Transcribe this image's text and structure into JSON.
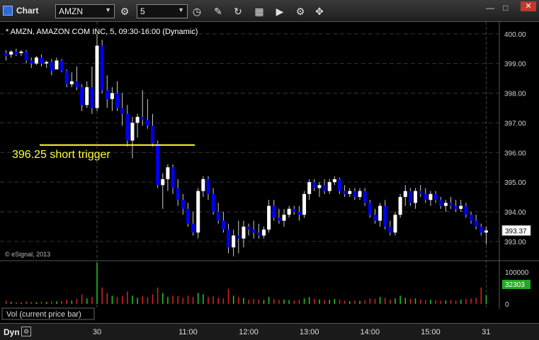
{
  "window": {
    "title": "Chart",
    "symbol": "AMZN",
    "interval": "5",
    "minimize": "—",
    "maximize": "□",
    "close": "✕"
  },
  "toolbar": {
    "icons": [
      "gear-icon",
      "clock-icon",
      "pencil-icon",
      "refresh-icon",
      "chart-type-icon",
      "play-icon",
      "settings-icon"
    ]
  },
  "chart_data": {
    "type": "candlestick",
    "title": "* AMZN, AMAZON COM INC, 5, 09:30-16:00 (Dynamic)",
    "watermark": "© eSignal, 2013",
    "ylim": [
      392.4,
      400.4
    ],
    "y_ticks": [
      "393.00",
      "394.00",
      "395.00",
      "396.00",
      "397.00",
      "398.00",
      "399.00",
      "400.00"
    ],
    "last_price": "393.37",
    "annotation": {
      "text": "396.25 short trigger",
      "price": 396.25
    },
    "volume_label": "Vol (current price bar)",
    "volume_tick": "100000",
    "volume_zero": "0",
    "volume_last": "32303",
    "x_labels": [
      "30",
      "11:00",
      "12:00",
      "13:00",
      "14:00",
      "15:00",
      "31"
    ],
    "x_label_bars": [
      18,
      36,
      48,
      60,
      72,
      84,
      96
    ],
    "up_color": "#ffffff",
    "down_color": "#0000ee",
    "candles": [
      [
        399.35,
        399.45,
        399.1,
        399.25
      ],
      [
        399.3,
        399.45,
        399.2,
        399.4
      ],
      [
        399.4,
        399.5,
        399.25,
        399.3
      ],
      [
        399.35,
        399.45,
        399.25,
        399.4
      ],
      [
        399.4,
        399.45,
        399.0,
        399.1
      ],
      [
        399.1,
        399.2,
        398.85,
        399.0
      ],
      [
        399.0,
        399.25,
        398.95,
        399.2
      ],
      [
        399.2,
        399.3,
        398.9,
        399.0
      ],
      [
        399.0,
        399.1,
        398.85,
        399.05
      ],
      [
        399.05,
        399.15,
        398.6,
        398.75
      ],
      [
        398.8,
        399.2,
        398.8,
        399.1
      ],
      [
        399.1,
        399.15,
        398.7,
        398.75
      ],
      [
        398.75,
        398.8,
        398.2,
        398.3
      ],
      [
        398.3,
        398.7,
        398.2,
        398.4
      ],
      [
        398.4,
        398.9,
        398.1,
        398.2
      ],
      [
        398.2,
        398.3,
        397.4,
        397.6
      ],
      [
        397.6,
        398.4,
        397.5,
        398.2
      ],
      [
        398.2,
        398.9,
        397.3,
        397.5
      ],
      [
        397.5,
        400.0,
        397.4,
        399.6
      ],
      [
        399.6,
        399.8,
        398.0,
        398.1
      ],
      [
        398.1,
        398.6,
        397.5,
        397.8
      ],
      [
        397.8,
        398.2,
        397.4,
        398.0
      ],
      [
        398.0,
        398.4,
        397.4,
        397.5
      ],
      [
        397.5,
        398.0,
        396.9,
        397.3
      ],
      [
        397.3,
        397.6,
        396.2,
        396.4
      ],
      [
        396.4,
        397.2,
        395.8,
        397.0
      ],
      [
        397.0,
        397.3,
        396.5,
        397.2
      ],
      [
        397.2,
        398.1,
        396.9,
        397.1
      ],
      [
        397.1,
        397.8,
        396.8,
        396.9
      ],
      [
        396.9,
        397.3,
        396.2,
        396.3
      ],
      [
        396.3,
        396.4,
        394.8,
        394.9
      ],
      [
        394.9,
        395.3,
        394.1,
        395.1
      ],
      [
        395.1,
        395.6,
        394.7,
        395.5
      ],
      [
        395.5,
        395.6,
        394.6,
        394.8
      ],
      [
        394.8,
        395.1,
        394.2,
        394.4
      ],
      [
        394.4,
        394.6,
        393.9,
        394.1
      ],
      [
        394.1,
        394.3,
        393.5,
        393.6
      ],
      [
        393.6,
        394.0,
        393.2,
        393.3
      ],
      [
        393.3,
        394.8,
        393.1,
        394.7
      ],
      [
        394.7,
        395.2,
        394.5,
        395.1
      ],
      [
        395.1,
        395.2,
        394.4,
        394.6
      ],
      [
        394.6,
        394.8,
        393.9,
        394.0
      ],
      [
        394.0,
        394.3,
        393.6,
        393.7
      ],
      [
        393.7,
        394.0,
        393.3,
        393.4
      ],
      [
        393.4,
        393.6,
        392.6,
        392.8
      ],
      [
        392.8,
        393.4,
        392.5,
        393.2
      ],
      [
        393.2,
        393.7,
        392.6,
        393.1
      ],
      [
        393.1,
        393.7,
        392.8,
        393.5
      ],
      [
        393.5,
        393.6,
        393.2,
        393.4
      ],
      [
        393.4,
        393.7,
        393.1,
        393.3
      ],
      [
        393.3,
        393.6,
        393.1,
        393.2
      ],
      [
        393.2,
        393.5,
        393.1,
        393.4
      ],
      [
        393.4,
        394.4,
        393.3,
        394.2
      ],
      [
        394.2,
        394.4,
        393.7,
        393.8
      ],
      [
        393.8,
        394.1,
        393.6,
        393.7
      ],
      [
        393.7,
        394.1,
        393.5,
        393.9
      ],
      [
        393.9,
        394.2,
        393.8,
        394.1
      ],
      [
        394.1,
        394.2,
        393.9,
        394.0
      ],
      [
        394.0,
        394.2,
        393.7,
        393.9
      ],
      [
        393.9,
        394.7,
        393.8,
        394.6
      ],
      [
        394.6,
        395.1,
        394.4,
        395.0
      ],
      [
        395.0,
        395.1,
        394.7,
        394.8
      ],
      [
        394.8,
        395.0,
        394.5,
        394.9
      ],
      [
        394.9,
        395.1,
        394.6,
        394.7
      ],
      [
        394.7,
        395.1,
        394.6,
        395.0
      ],
      [
        395.0,
        395.2,
        394.9,
        395.1
      ],
      [
        395.1,
        395.15,
        394.6,
        394.7
      ],
      [
        394.7,
        394.9,
        394.5,
        394.6
      ],
      [
        394.6,
        394.8,
        394.5,
        394.7
      ],
      [
        394.7,
        394.8,
        394.4,
        394.5
      ],
      [
        394.5,
        394.8,
        394.4,
        394.7
      ],
      [
        394.7,
        394.8,
        394.2,
        394.3
      ],
      [
        394.3,
        394.4,
        393.8,
        393.9
      ],
      [
        393.9,
        394.1,
        393.6,
        393.7
      ],
      [
        393.7,
        394.3,
        393.5,
        394.2
      ],
      [
        394.2,
        394.4,
        393.4,
        393.5
      ],
      [
        393.5,
        393.7,
        393.2,
        393.3
      ],
      [
        393.3,
        394.0,
        393.2,
        393.9
      ],
      [
        393.9,
        394.6,
        393.8,
        394.5
      ],
      [
        394.5,
        394.9,
        394.2,
        394.7
      ],
      [
        394.7,
        394.8,
        394.2,
        394.3
      ],
      [
        394.3,
        394.8,
        394.1,
        394.7
      ],
      [
        394.7,
        394.9,
        394.5,
        394.6
      ],
      [
        394.6,
        394.8,
        394.3,
        394.4
      ],
      [
        394.4,
        394.7,
        394.2,
        394.6
      ],
      [
        394.6,
        394.7,
        394.3,
        394.4
      ],
      [
        394.4,
        394.5,
        394.1,
        394.2
      ],
      [
        394.2,
        394.4,
        394.0,
        394.3
      ],
      [
        394.3,
        394.5,
        394.1,
        394.2
      ],
      [
        394.2,
        394.4,
        394.0,
        394.1
      ],
      [
        394.1,
        394.4,
        394.0,
        394.2
      ],
      [
        394.2,
        394.3,
        393.8,
        393.9
      ],
      [
        393.9,
        394.0,
        393.6,
        393.7
      ],
      [
        393.7,
        393.9,
        393.4,
        393.5
      ],
      [
        393.5,
        393.6,
        393.2,
        393.3
      ],
      [
        393.3,
        393.5,
        392.9,
        393.37
      ]
    ],
    "volumes": [
      12000,
      8000,
      6000,
      5000,
      9000,
      7000,
      6000,
      8000,
      7000,
      10000,
      9000,
      11000,
      15000,
      12000,
      18000,
      35000,
      20000,
      25000,
      150000,
      60000,
      40000,
      30000,
      25000,
      28000,
      45000,
      30000,
      22000,
      28000,
      24000,
      35000,
      60000,
      40000,
      25000,
      30000,
      28000,
      22000,
      30000,
      25000,
      40000,
      35000,
      25000,
      28000,
      22000,
      20000,
      55000,
      30000,
      25000,
      22000,
      15000,
      18000,
      16000,
      14000,
      25000,
      18000,
      15000,
      16000,
      14000,
      12000,
      15000,
      20000,
      25000,
      18000,
      16000,
      14000,
      15000,
      18000,
      16000,
      12000,
      10000,
      12000,
      11000,
      14000,
      20000,
      18000,
      25000,
      22000,
      15000,
      20000,
      30000,
      22000,
      18000,
      20000,
      16000,
      14000,
      15000,
      14000,
      12000,
      13000,
      14000,
      12000,
      15000,
      18000,
      20000,
      22000,
      60000,
      32303
    ]
  }
}
